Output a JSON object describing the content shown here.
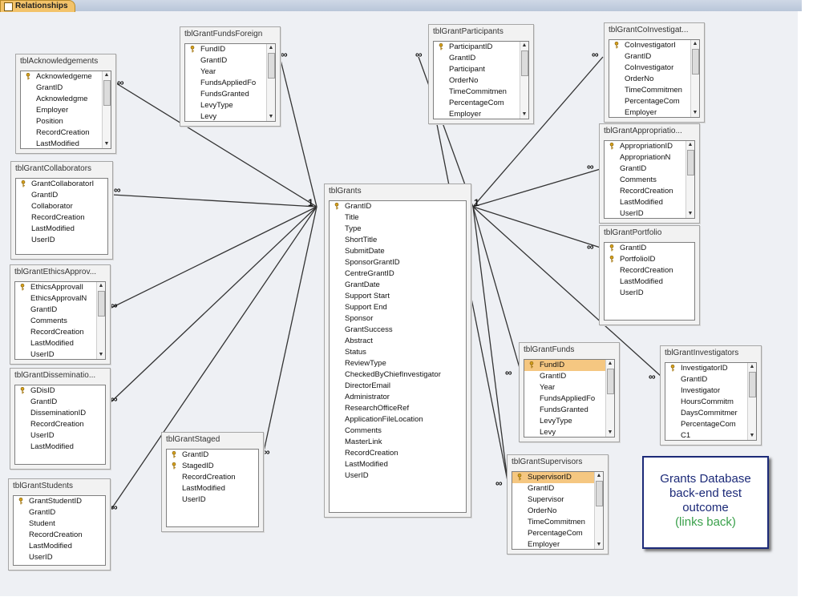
{
  "tab": {
    "label": "Relationships"
  },
  "note": {
    "line1": "Grants Database",
    "line2": "back-end test",
    "line3": "outcome",
    "line4": "(links back)"
  },
  "tables": {
    "acknowledgements": {
      "title": "tblAcknowledgements",
      "fields": [
        "Acknowledgeme",
        "GrantID",
        "Acknowledgme",
        "Employer",
        "Position",
        "RecordCreation",
        "LastModified"
      ],
      "keys": [
        0
      ],
      "scrollbar": true
    },
    "fundsForeign": {
      "title": "tblGrantFundsForeign",
      "fields": [
        "FundID",
        "GrantID",
        "Year",
        "FundsAppliedFo",
        "FundsGranted",
        "LevyType",
        "Levy"
      ],
      "keys": [
        0
      ],
      "scrollbar": true
    },
    "participants": {
      "title": "tblGrantParticipants",
      "fields": [
        "ParticipantID",
        "GrantID",
        "Participant",
        "OrderNo",
        "TimeCommitmen",
        "PercentageCom",
        "Employer"
      ],
      "keys": [
        0
      ],
      "scrollbar": true
    },
    "coInvestigators": {
      "title": "tblGrantCoInvestigat...",
      "fields": [
        "CoInvestigatorI",
        "GrantID",
        "CoInvestigator",
        "OrderNo",
        "TimeCommitmen",
        "PercentageCom",
        "Employer"
      ],
      "keys": [
        0
      ],
      "scrollbar": true
    },
    "collaborators": {
      "title": "tblGrantCollaborators",
      "fields": [
        "GrantCollaboratorI",
        "GrantID",
        "Collaborator",
        "RecordCreation",
        "LastModified",
        "UserID"
      ],
      "keys": [
        0
      ],
      "scrollbar": false
    },
    "appropriations": {
      "title": "tblGrantAppropriatio...",
      "fields": [
        "AppropriationID",
        "AppropriationN",
        "GrantID",
        "Comments",
        "RecordCreation",
        "LastModified",
        "UserID"
      ],
      "keys": [
        0
      ],
      "scrollbar": true
    },
    "grants": {
      "title": "tblGrants",
      "fields": [
        "GrantID",
        "Title",
        "Type",
        "ShortTitle",
        "SubmitDate",
        "SponsorGrantID",
        "CentreGrantID",
        "GrantDate",
        "Support Start",
        "Support End",
        "Sponsor",
        "GrantSuccess",
        "Abstract",
        "Status",
        "ReviewType",
        "CheckedByChiefInvestigator",
        "DirectorEmail",
        "Administrator",
        "ResearchOfficeRef",
        "ApplicationFileLocation",
        "Comments",
        "MasterLink",
        "RecordCreation",
        "LastModified",
        "UserID"
      ],
      "keys": [
        0
      ],
      "scrollbar": false
    },
    "portfolio": {
      "title": "tblGrantPortfolio",
      "fields": [
        "GrantID",
        "PortfolioID",
        "RecordCreation",
        "LastModified",
        "UserID"
      ],
      "keys": [
        0,
        1
      ],
      "scrollbar": false
    },
    "ethics": {
      "title": "tblGrantEthicsApprov...",
      "fields": [
        "EthicsApprovalI",
        "EthicsApprovalN",
        "GrantID",
        "Comments",
        "RecordCreation",
        "LastModified",
        "UserID"
      ],
      "keys": [
        0
      ],
      "scrollbar": true
    },
    "dissemination": {
      "title": "tblGrantDisseminatio...",
      "fields": [
        "GDisID",
        "GrantID",
        "DisseminationID",
        "RecordCreation",
        "UserID",
        "LastModified"
      ],
      "keys": [
        0
      ],
      "scrollbar": false
    },
    "funds": {
      "title": "tblGrantFunds",
      "fields": [
        "FundID",
        "GrantID",
        "Year",
        "FundsAppliedFo",
        "FundsGranted",
        "LevyType",
        "Levy"
      ],
      "keys": [
        0
      ],
      "selected": 0,
      "scrollbar": true
    },
    "investigators": {
      "title": "tblGrantInvestigators",
      "fields": [
        "InvestigatorID",
        "GrantID",
        "Investigator",
        "HoursCommitm",
        "DaysCommitmer",
        "PercentageCom",
        "C1"
      ],
      "keys": [
        0
      ],
      "scrollbar": true
    },
    "staged": {
      "title": "tblGrantStaged",
      "fields": [
        "GrantID",
        "StagedID",
        "RecordCreation",
        "LastModified",
        "UserID"
      ],
      "keys": [
        0,
        1
      ],
      "scrollbar": false
    },
    "students": {
      "title": "tblGrantStudents",
      "fields": [
        "GrantStudentID",
        "GrantID",
        "Student",
        "RecordCreation",
        "LastModified",
        "UserID"
      ],
      "keys": [
        0
      ],
      "scrollbar": false
    },
    "supervisors": {
      "title": "tblGrantSupervisors",
      "fields": [
        "SupervisorID",
        "GrantID",
        "Supervisor",
        "OrderNo",
        "TimeCommitmen",
        "PercentageCom",
        "Employer"
      ],
      "keys": [
        0
      ],
      "selected": 0,
      "scrollbar": true
    }
  },
  "relationship_marks": {
    "one": "1",
    "many": "∞"
  }
}
